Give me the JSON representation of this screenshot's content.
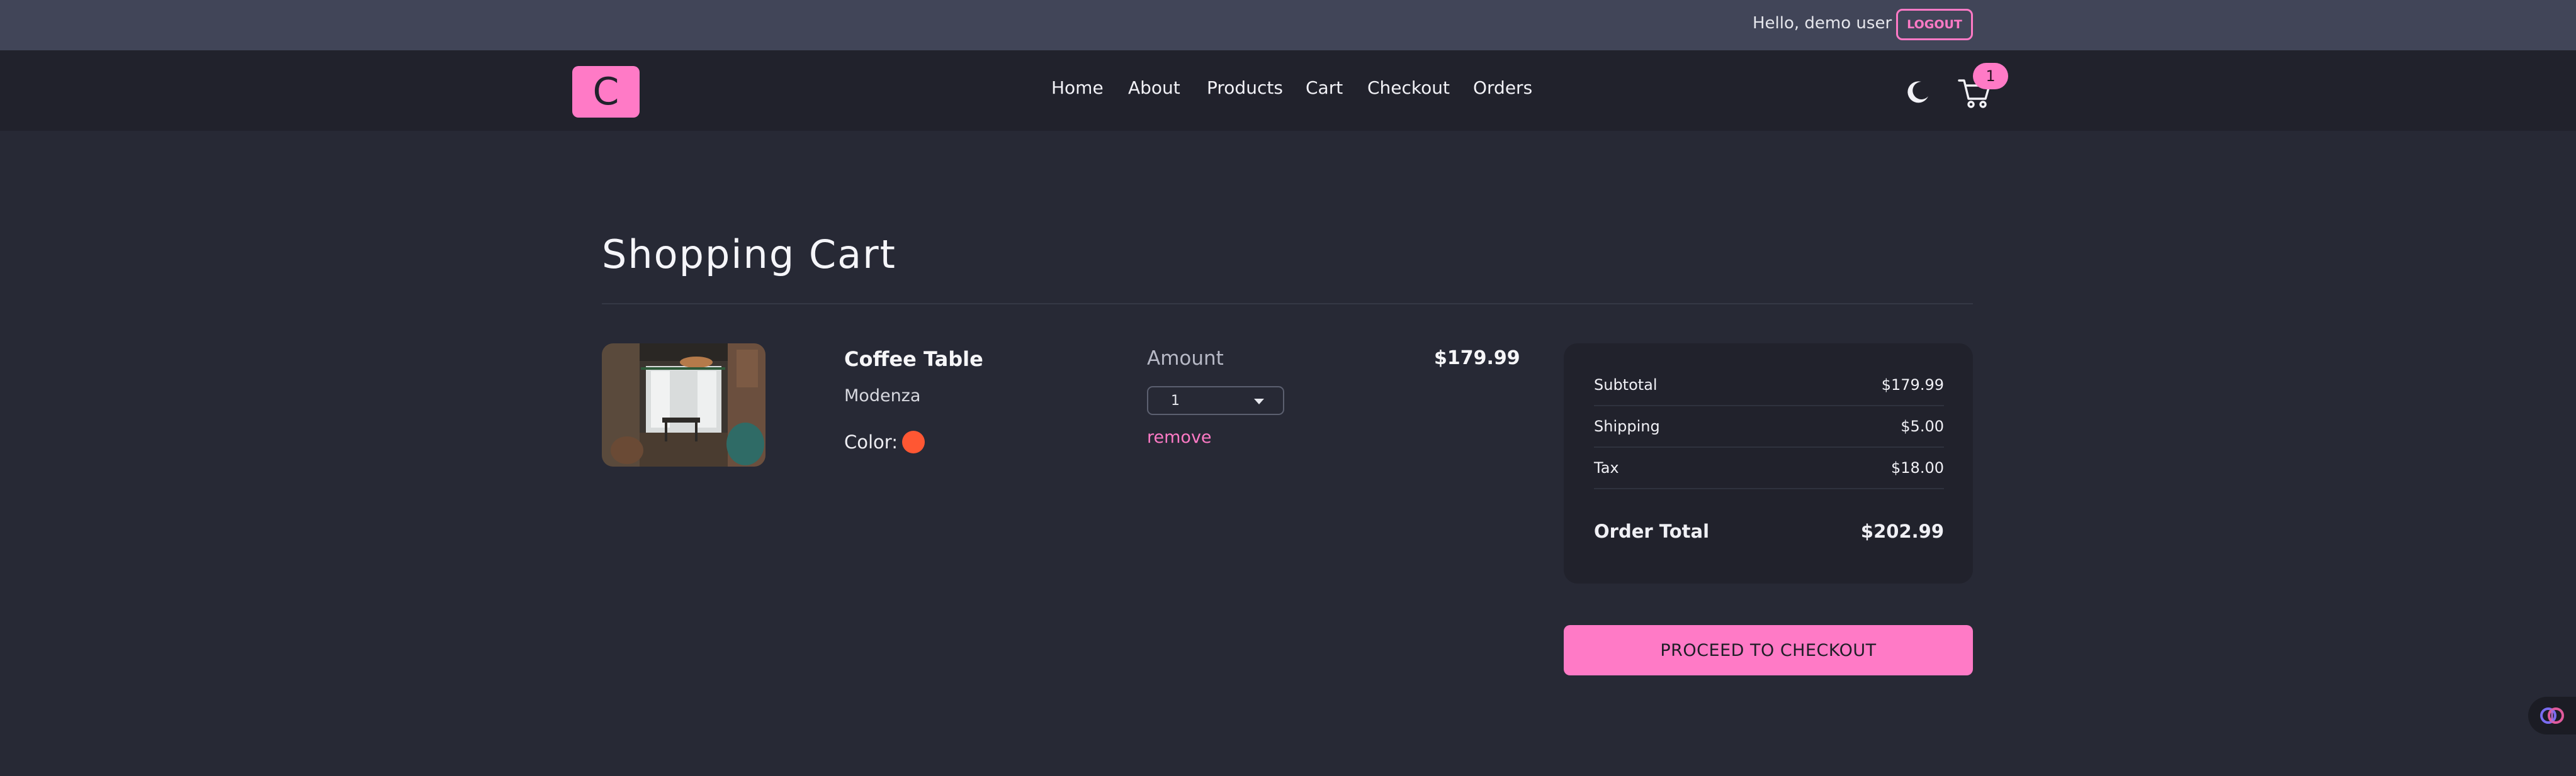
{
  "user_bar": {
    "greeting": "Hello, demo user",
    "logout_label": "LOGOUT"
  },
  "navbar": {
    "logo_text": "C",
    "links": [
      "Home",
      "About",
      "Products",
      "Cart",
      "Checkout",
      "Orders"
    ],
    "theme_icon": "moon-icon",
    "cart_icon": "cart-icon",
    "cart_count": "1"
  },
  "page": {
    "title": "Shopping Cart"
  },
  "cart_item": {
    "name": "Coffee Table",
    "company": "Modenza",
    "color_label": "Color:",
    "color_value": "#ff5733",
    "amount_label": "Amount",
    "amount_value": "1",
    "remove_label": "remove",
    "price": "$179.99"
  },
  "totals": {
    "subtotal_label": "Subtotal",
    "subtotal_value": "$179.99",
    "shipping_label": "Shipping",
    "shipping_value": "$5.00",
    "tax_label": "Tax",
    "tax_value": "$18.00",
    "order_total_label": "Order Total",
    "order_total_value": "$202.99"
  },
  "checkout_button": {
    "label": "PROCEED TO CHECKOUT"
  },
  "colors": {
    "accent": "#ff7ac6",
    "background": "#272935",
    "navbar": "#21222c",
    "topbar": "#414558"
  }
}
